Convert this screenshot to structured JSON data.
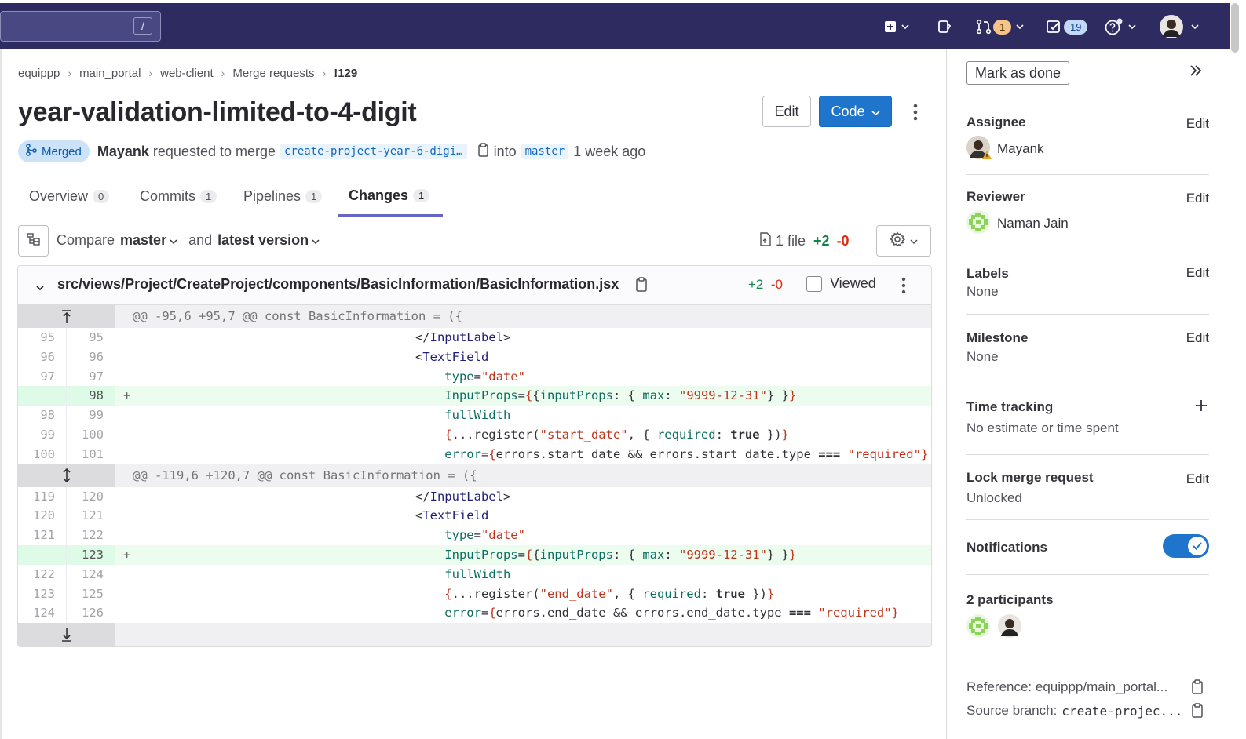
{
  "topbar": {
    "search_kbd": "/",
    "mr_count": "1",
    "todo_count": "19"
  },
  "breadcrumb": [
    "equippp",
    "main_portal",
    "web-client",
    "Merge requests",
    "!129"
  ],
  "title": "year-validation-limited-to-4-digit",
  "actions": {
    "edit": "Edit",
    "code": "Code"
  },
  "meta": {
    "status": "Merged",
    "author": "Mayank",
    "requested": "requested to merge",
    "source_branch": "create-project-year-6-digi…",
    "into": "into",
    "target_branch": "master",
    "time": "1 week ago"
  },
  "tabs": [
    {
      "label": "Overview",
      "count": "0"
    },
    {
      "label": "Commits",
      "count": "1"
    },
    {
      "label": "Pipelines",
      "count": "1"
    },
    {
      "label": "Changes",
      "count": "1"
    }
  ],
  "compare": {
    "label": "Compare",
    "base": "master",
    "and": "and",
    "head": "latest version"
  },
  "filestat": {
    "files": "1 file",
    "add": "+2",
    "del": "-0"
  },
  "file": {
    "path": "src/views/Project/CreateProject/components/BasicInformation/BasicInformation.jsx",
    "add": "+2",
    "del": "-0",
    "viewed": "Viewed"
  },
  "hunks": [
    "@@ -95,6 +95,7 @@ const BasicInformation = ({",
    "@@ -119,6 +120,7 @@ const BasicInformation = ({"
  ],
  "lines1": [
    {
      "a": "95",
      "b": "95"
    },
    {
      "a": "96",
      "b": "96"
    },
    {
      "a": "97",
      "b": "97"
    },
    {
      "a": "",
      "b": "98"
    },
    {
      "a": "98",
      "b": "99"
    },
    {
      "a": "99",
      "b": "100"
    },
    {
      "a": "100",
      "b": "101"
    }
  ],
  "lines2": [
    {
      "a": "119",
      "b": "120"
    },
    {
      "a": "120",
      "b": "121"
    },
    {
      "a": "121",
      "b": "122"
    },
    {
      "a": "",
      "b": "123"
    },
    {
      "a": "122",
      "b": "124"
    },
    {
      "a": "123",
      "b": "125"
    },
    {
      "a": "124",
      "b": "126"
    }
  ],
  "sidebar": {
    "mark_done": "Mark as done",
    "edit": "Edit",
    "assignee_h": "Assignee",
    "assignee": "Mayank",
    "reviewer_h": "Reviewer",
    "reviewer": "Naman Jain",
    "labels_h": "Labels",
    "labels": "None",
    "milestone_h": "Milestone",
    "milestone": "None",
    "time_h": "Time tracking",
    "time": "No estimate or time spent",
    "lock_h": "Lock merge request",
    "lock": "Unlocked",
    "notif_h": "Notifications",
    "participants_h": "2 participants",
    "reference": "Reference: equippp/main_portal...",
    "source_label": "Source branch:",
    "source": "create-projec..."
  },
  "colors": {
    "topbar": "#2d2b5f",
    "primary": "#1f75cb",
    "added_bg": "#ecfdf0",
    "add": "#108548",
    "del": "#dd2b0e"
  }
}
